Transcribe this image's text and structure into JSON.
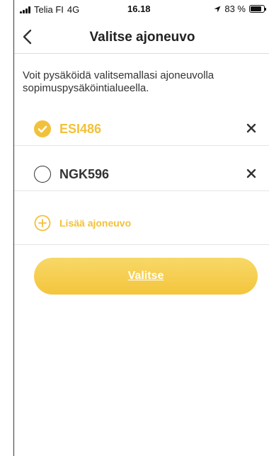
{
  "status_bar": {
    "carrier": "Telia FI",
    "network": "4G",
    "time": "16.18",
    "battery": "83 %",
    "battery_level": 0.83
  },
  "header": {
    "title": "Valitse ajoneuvo",
    "back_icon": "chevron-left-icon"
  },
  "description": "Voit pysäköidä valitsemallasi ajoneuvolla sopimuspysäköintialueella.",
  "vehicles": [
    {
      "plate": "ESI486",
      "selected": true
    },
    {
      "plate": "NGK596",
      "selected": false
    }
  ],
  "add_vehicle": {
    "label": "Lisää ajoneuvo",
    "icon": "plus-circle-icon"
  },
  "primary_button": {
    "label": "Valitse"
  },
  "colors": {
    "accent": "#f2c13b",
    "text": "#333333",
    "button_top": "#f7d867",
    "button_bottom": "#f4c53c"
  }
}
